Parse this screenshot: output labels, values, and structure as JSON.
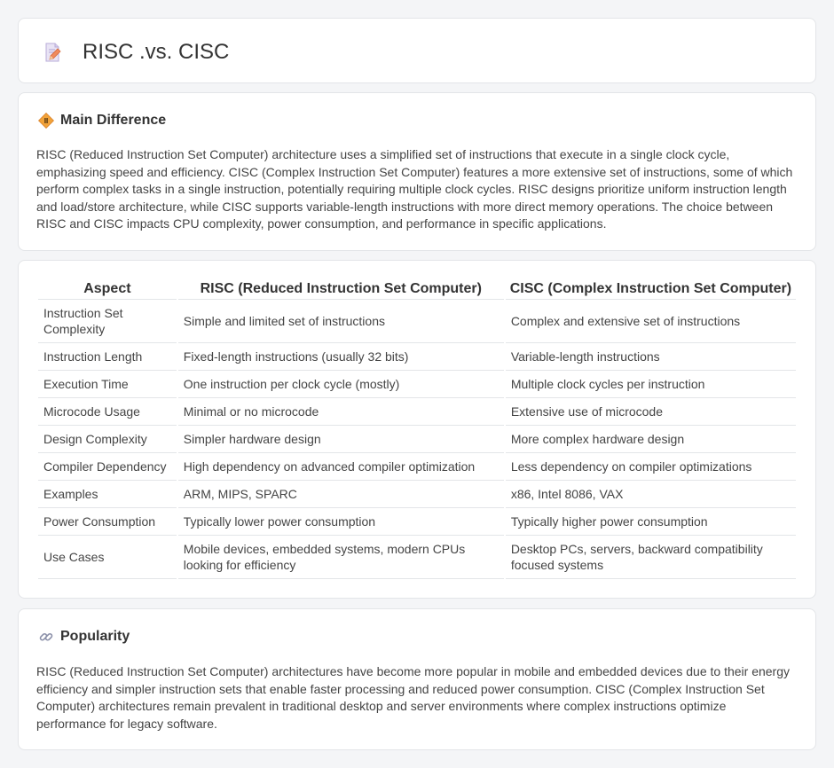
{
  "header": {
    "title": "RISC .vs. CISC",
    "icon": "document-pencil-icon"
  },
  "main_difference": {
    "heading": "Main Difference",
    "icon": "diamond-sign-icon",
    "text": "RISC (Reduced Instruction Set Computer) architecture uses a simplified set of instructions that execute in a single clock cycle, emphasizing speed and efficiency. CISC (Complex Instruction Set Computer) features a more extensive set of instructions, some of which perform complex tasks in a single instruction, potentially requiring multiple clock cycles. RISC designs prioritize uniform instruction length and load/store architecture, while CISC supports variable-length instructions with more direct memory operations. The choice between RISC and CISC impacts CPU complexity, power consumption, and performance in specific applications."
  },
  "comparison": {
    "headers": [
      "Aspect",
      "RISC (Reduced Instruction Set Computer)",
      "CISC (Complex Instruction Set Computer)"
    ],
    "rows": [
      [
        "Instruction Set Complexity",
        "Simple and limited set of instructions",
        "Complex and extensive set of instructions"
      ],
      [
        "Instruction Length",
        "Fixed-length instructions (usually 32 bits)",
        "Variable-length instructions"
      ],
      [
        "Execution Time",
        "One instruction per clock cycle (mostly)",
        "Multiple clock cycles per instruction"
      ],
      [
        "Microcode Usage",
        "Minimal or no microcode",
        "Extensive use of microcode"
      ],
      [
        "Design Complexity",
        "Simpler hardware design",
        "More complex hardware design"
      ],
      [
        "Compiler Dependency",
        "High dependency on advanced compiler optimization",
        "Less dependency on compiler optimizations"
      ],
      [
        "Examples",
        "ARM, MIPS, SPARC",
        "x86, Intel 8086, VAX"
      ],
      [
        "Power Consumption",
        "Typically lower power consumption",
        "Typically higher power consumption"
      ],
      [
        "Use Cases",
        "Mobile devices, embedded systems, modern CPUs looking for efficiency",
        "Desktop PCs, servers, backward compatibility focused systems"
      ]
    ]
  },
  "popularity": {
    "heading": "Popularity",
    "icon": "link-icon",
    "text": "RISC (Reduced Instruction Set Computer) architectures have become more popular in mobile and embedded devices due to their energy efficiency and simpler instruction sets that enable faster processing and reduced power consumption. CISC (Complex Instruction Set Computer) architectures remain prevalent in traditional desktop and server environments where complex instructions optimize performance for legacy software."
  }
}
